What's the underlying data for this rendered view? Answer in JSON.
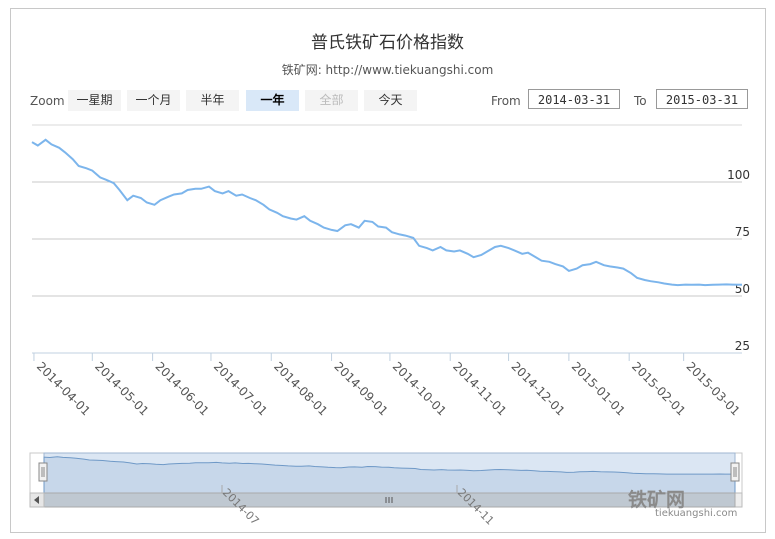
{
  "chart_data": {
    "type": "line",
    "title": "普氏铁矿石价格指数",
    "subtitle": "铁矿网: http://www.tiekuangshi.com",
    "y_ticks": [
      25,
      50,
      75,
      100
    ],
    "ylim": [
      25,
      125
    ],
    "x_ticks": [
      "2014-04-01",
      "2014-05-01",
      "2014-06-01",
      "2014-07-01",
      "2014-08-01",
      "2014-09-01",
      "2014-10-01",
      "2014-11-01",
      "2014-12-01",
      "2015-01-01",
      "2015-02-01",
      "2015-03-01"
    ],
    "x_range": [
      "2014-03-31",
      "2015-03-31"
    ],
    "grid": true,
    "color": "#7cb5ec",
    "series": [
      {
        "x": [
          "2014-03-31",
          "2014-04-03",
          "2014-04-07",
          "2014-04-10",
          "2014-04-14",
          "2014-04-17",
          "2014-04-21",
          "2014-04-24",
          "2014-04-28",
          "2014-05-01",
          "2014-05-05",
          "2014-05-08",
          "2014-05-12",
          "2014-05-15",
          "2014-05-19",
          "2014-05-22",
          "2014-05-26",
          "2014-05-29",
          "2014-06-02",
          "2014-06-05",
          "2014-06-09",
          "2014-06-12",
          "2014-06-16",
          "2014-06-19",
          "2014-06-23",
          "2014-06-26",
          "2014-06-30",
          "2014-07-03",
          "2014-07-07",
          "2014-07-10",
          "2014-07-14",
          "2014-07-17",
          "2014-07-21",
          "2014-07-24",
          "2014-07-28",
          "2014-07-31",
          "2014-08-04",
          "2014-08-07",
          "2014-08-11",
          "2014-08-14",
          "2014-08-18",
          "2014-08-21",
          "2014-08-25",
          "2014-08-28",
          "2014-09-01",
          "2014-09-04",
          "2014-09-08",
          "2014-09-11",
          "2014-09-15",
          "2014-09-18",
          "2014-09-22",
          "2014-09-25",
          "2014-09-29",
          "2014-10-02",
          "2014-10-06",
          "2014-10-09",
          "2014-10-13",
          "2014-10-16",
          "2014-10-20",
          "2014-10-23",
          "2014-10-27",
          "2014-10-30",
          "2014-11-03",
          "2014-11-06",
          "2014-11-10",
          "2014-11-13",
          "2014-11-17",
          "2014-11-20",
          "2014-11-24",
          "2014-11-27",
          "2014-12-01",
          "2014-12-04",
          "2014-12-08",
          "2014-12-11",
          "2014-12-15",
          "2014-12-18",
          "2014-12-22",
          "2014-12-25",
          "2014-12-29",
          "2015-01-01",
          "2015-01-05",
          "2015-01-08",
          "2015-01-12",
          "2015-01-15",
          "2015-01-19",
          "2015-01-22",
          "2015-01-26",
          "2015-01-29",
          "2015-02-02",
          "2015-02-05",
          "2015-02-09",
          "2015-02-12",
          "2015-02-16",
          "2015-02-19",
          "2015-02-23",
          "2015-02-26",
          "2015-03-02",
          "2015-03-05",
          "2015-03-09",
          "2015-03-12",
          "2015-03-16",
          "2015-03-19",
          "2015-03-23",
          "2015-03-26",
          "2015-03-31"
        ],
        "values": [
          117.5,
          116,
          118.5,
          116.5,
          115,
          113,
          110,
          107,
          106,
          105,
          102,
          101,
          99.5,
          96.5,
          92,
          94,
          93,
          91,
          90,
          92,
          93.5,
          94.5,
          95,
          96.5,
          97,
          97,
          98,
          96,
          95,
          96,
          94,
          94.5,
          93,
          92,
          90,
          88,
          86.5,
          85,
          84,
          83.5,
          85,
          83,
          81.5,
          80,
          79,
          78.5,
          81,
          81.5,
          80,
          83,
          82.5,
          80.5,
          80,
          78,
          77,
          76.5,
          75.5,
          72,
          71,
          70,
          71.5,
          70,
          69.5,
          70,
          68.5,
          67,
          68,
          69.5,
          71.5,
          72,
          71,
          70,
          68.5,
          69,
          67,
          65.5,
          65,
          64,
          63,
          61,
          62,
          63.5,
          64,
          65,
          63.5,
          63,
          62.5,
          62,
          60,
          58,
          57,
          56.5,
          56,
          55.5,
          55,
          54.8,
          55,
          54.9,
          55,
          54.8,
          54.9,
          55,
          55.1,
          55.0,
          54.9
        ]
      }
    ]
  },
  "toolbar": {
    "zoom_label": "Zoom",
    "buttons": [
      "一星期",
      "一个月",
      "半年",
      "一年",
      "全部",
      "今天"
    ],
    "from_label": "From",
    "from_value": "2014-03-31",
    "to_label": "To",
    "to_value": "2015-03-31"
  },
  "navigator": {
    "labels": [
      "2014-07",
      "2014-11"
    ]
  },
  "watermark": {
    "text": "铁矿网",
    "url": "tiekuangshi.com"
  }
}
